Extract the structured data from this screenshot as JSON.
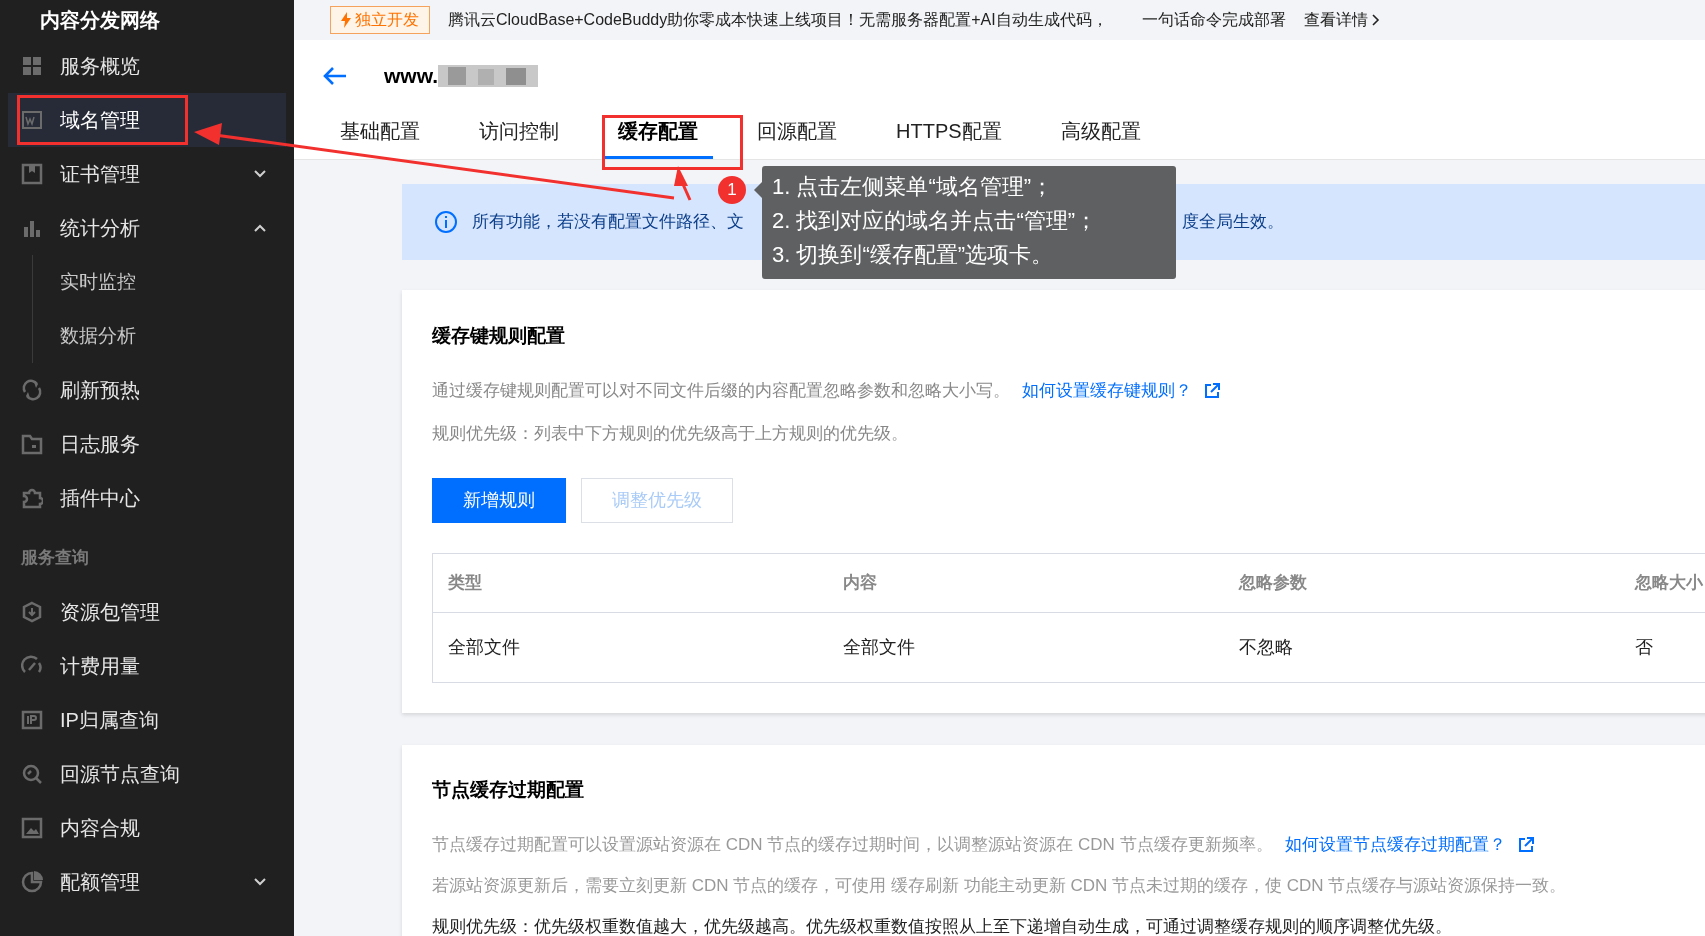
{
  "sidebar": {
    "title": "内容分发网络",
    "items": [
      {
        "kind": "item",
        "label": "服务概览",
        "selected": false
      },
      {
        "kind": "item",
        "label": "域名管理",
        "selected": true
      },
      {
        "kind": "item",
        "label": "证书管理",
        "selected": false,
        "expanded": false
      },
      {
        "kind": "item",
        "label": "统计分析",
        "selected": false,
        "expanded": true
      },
      {
        "kind": "subitem",
        "label": "实时监控",
        "selected": false
      },
      {
        "kind": "subitem",
        "label": "数据分析",
        "selected": false
      },
      {
        "kind": "item",
        "label": "刷新预热",
        "selected": false
      },
      {
        "kind": "item",
        "label": "日志服务",
        "selected": false
      },
      {
        "kind": "item",
        "label": "插件中心",
        "selected": false
      },
      {
        "kind": "section",
        "label": "服务查询"
      },
      {
        "kind": "item",
        "label": "资源包管理",
        "selected": false
      },
      {
        "kind": "item",
        "label": "计费用量",
        "selected": false
      },
      {
        "kind": "item",
        "label": "IP归属查询",
        "selected": false
      },
      {
        "kind": "item",
        "label": "回源节点查询",
        "selected": false
      },
      {
        "kind": "item",
        "label": "内容合规",
        "selected": false
      },
      {
        "kind": "item",
        "label": "配额管理",
        "selected": false,
        "expanded": false
      }
    ]
  },
  "promo": {
    "badge": "独立开发",
    "text": "腾讯云CloudBase+CodeBuddy助你零成本快速上线项目！无需服务器配置+AI自动生成代码，",
    "text_2": "一句话命令完成部署",
    "link": "查看详情"
  },
  "header": {
    "domain": "www.",
    "tabs": [
      {
        "label": "基础配置",
        "selected": false
      },
      {
        "label": "访问控制",
        "selected": false
      },
      {
        "label": "缓存配置",
        "selected": true
      },
      {
        "label": "回源配置",
        "selected": false
      },
      {
        "label": "HTTPS配置",
        "selected": false
      },
      {
        "label": "高级配置",
        "selected": false
      }
    ]
  },
  "notice": {
    "text_before": "所有功能，若没有配置文件路径、文",
    "text_after": "度全局生效。"
  },
  "annotation": {
    "step": "1",
    "lines": [
      "1. 点击左侧菜单“域名管理”；",
      "2. 找到对应的域名并点击“管理”；",
      "3. 切换到“缓存配置”选项卡。"
    ]
  },
  "cache_key_card": {
    "title": "缓存键规则配置",
    "description": "通过缓存键规则配置可以对不同文件后缀的内容配置忽略参数和忽略大小写。",
    "link": "如何设置缓存键规则？",
    "priority": "规则优先级：列表中下方规则的优先级高于上方规则的优先级。",
    "buttons": [
      {
        "label": "新增规则",
        "kind": "primary",
        "disabled": false
      },
      {
        "label": "调整优先级",
        "kind": "secondary",
        "disabled": true
      }
    ],
    "table": {
      "columns": [
        "类型",
        "内容",
        "忽略参数",
        "忽略大小"
      ],
      "rows": [
        [
          "全部文件",
          "全部文件",
          "不忽略",
          "否"
        ]
      ]
    }
  },
  "node_cache_card": {
    "title": "节点缓存过期配置",
    "paragraphs": [
      {
        "text": "节点缓存过期配置可以设置源站资源在 CDN 节点的缓存过期时间，以调整源站资源在 CDN 节点缓存更新频率。",
        "muted": true,
        "link": "如何设置节点缓存过期配置？"
      },
      {
        "text": "若源站资源更新后，需要立刻更新 CDN 节点的缓存，可使用 缓存刷新 功能主动更新 CDN 节点未过期的缓存，使 CDN 节点缓存与源站资源保持一致。",
        "muted": true
      },
      {
        "text": "规则优先级：优先级权重数值越大，优先级越高。优先级权重数值按照从上至下递增自动生成，可通过调整缓存规则的顺序调整优先级。",
        "muted": false
      }
    ]
  }
}
